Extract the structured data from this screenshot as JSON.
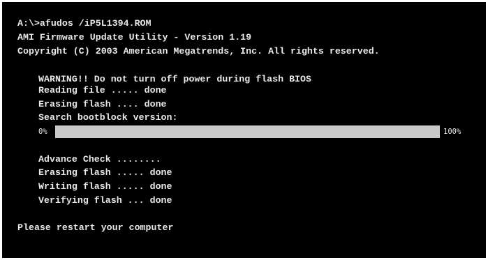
{
  "terminal": {
    "command": "A:\\>afudos /iP5L1394.ROM",
    "title": "AMI Firmware Update Utility - Version 1.19",
    "copyright": "Copyright (C) 2003 American Megatrends, Inc. All rights reserved.",
    "warning": "WARNING!! Do not turn off power during flash BIOS",
    "reading": "Reading file ..... done",
    "erasing1": "Erasing flash .... done",
    "search": "Search bootblock version:",
    "progress": {
      "start_label": "0%",
      "end_label": "100%",
      "value": 1.0,
      "fill_color": "#c9c9c9"
    },
    "advance": "Advance Check ........",
    "erasing2": "Erasing flash ..... done",
    "writing": "Writing flash ..... done",
    "verifying": "Verifying flash ... done",
    "restart": "Please restart your computer"
  },
  "colors": {
    "background": "#000000",
    "text": "#e8e8e8"
  }
}
